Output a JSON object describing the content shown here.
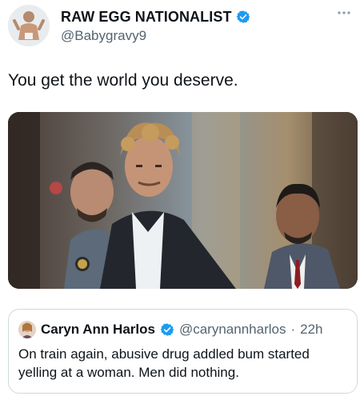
{
  "post": {
    "author": {
      "display_name": "RAW EGG NATIONALIST",
      "handle": "@Babygravy9",
      "verified": true
    },
    "more_icon": "more-horizontal-icon",
    "text": "You get the world you deserve.",
    "media": {
      "type": "photo"
    }
  },
  "quoted_post": {
    "author": {
      "display_name": "Caryn Ann Harlos",
      "handle": "@carynannharlos",
      "verified": true
    },
    "separator": "·",
    "time": "22h",
    "text": "On train again, abusive drug addled bum started yelling at a woman.  Men did nothing."
  },
  "colors": {
    "verified_blue": "#1d9bf0",
    "secondary_text": "#536471",
    "border": "#cfd9de"
  }
}
